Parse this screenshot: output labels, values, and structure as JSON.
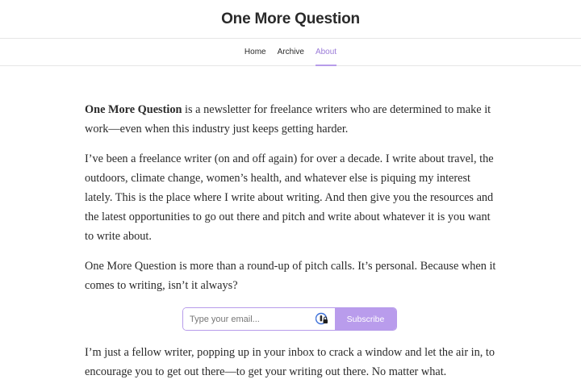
{
  "header": {
    "title": "One More Question"
  },
  "nav": {
    "items": [
      {
        "label": "Home",
        "active": false
      },
      {
        "label": "Archive",
        "active": false
      },
      {
        "label": "About",
        "active": true
      }
    ]
  },
  "content": {
    "p1_bold": "One More Question",
    "p1_rest": " is a newsletter for freelance writers who are determined to make it work—even when this industry just keeps getting harder.",
    "p2": "I’ve been a freelance writer (on and off again) for over a decade. I write about travel, the outdoors, climate change, women’s health, and whatever else is piquing my interest lately. This is the place where I write about writing. And then give you the resources and the latest opportunities to go out there and pitch and write about whatever it is you want to write about.",
    "p3": "One More Question is more than a round-up of pitch calls. It’s personal. Because when it comes to writing, isn’t it always?",
    "p4": "I’m just a fellow writer, popping up in your inbox to crack a window and let the air in, to encourage you to get out there—to get your writing out there. No matter what."
  },
  "subscribe": {
    "placeholder": "Type your email...",
    "value": "",
    "button_label": "Subscribe",
    "icon": "password-manager-icon"
  },
  "colors": {
    "accent": "#b99cec",
    "active_nav": "#9b7bd8"
  }
}
